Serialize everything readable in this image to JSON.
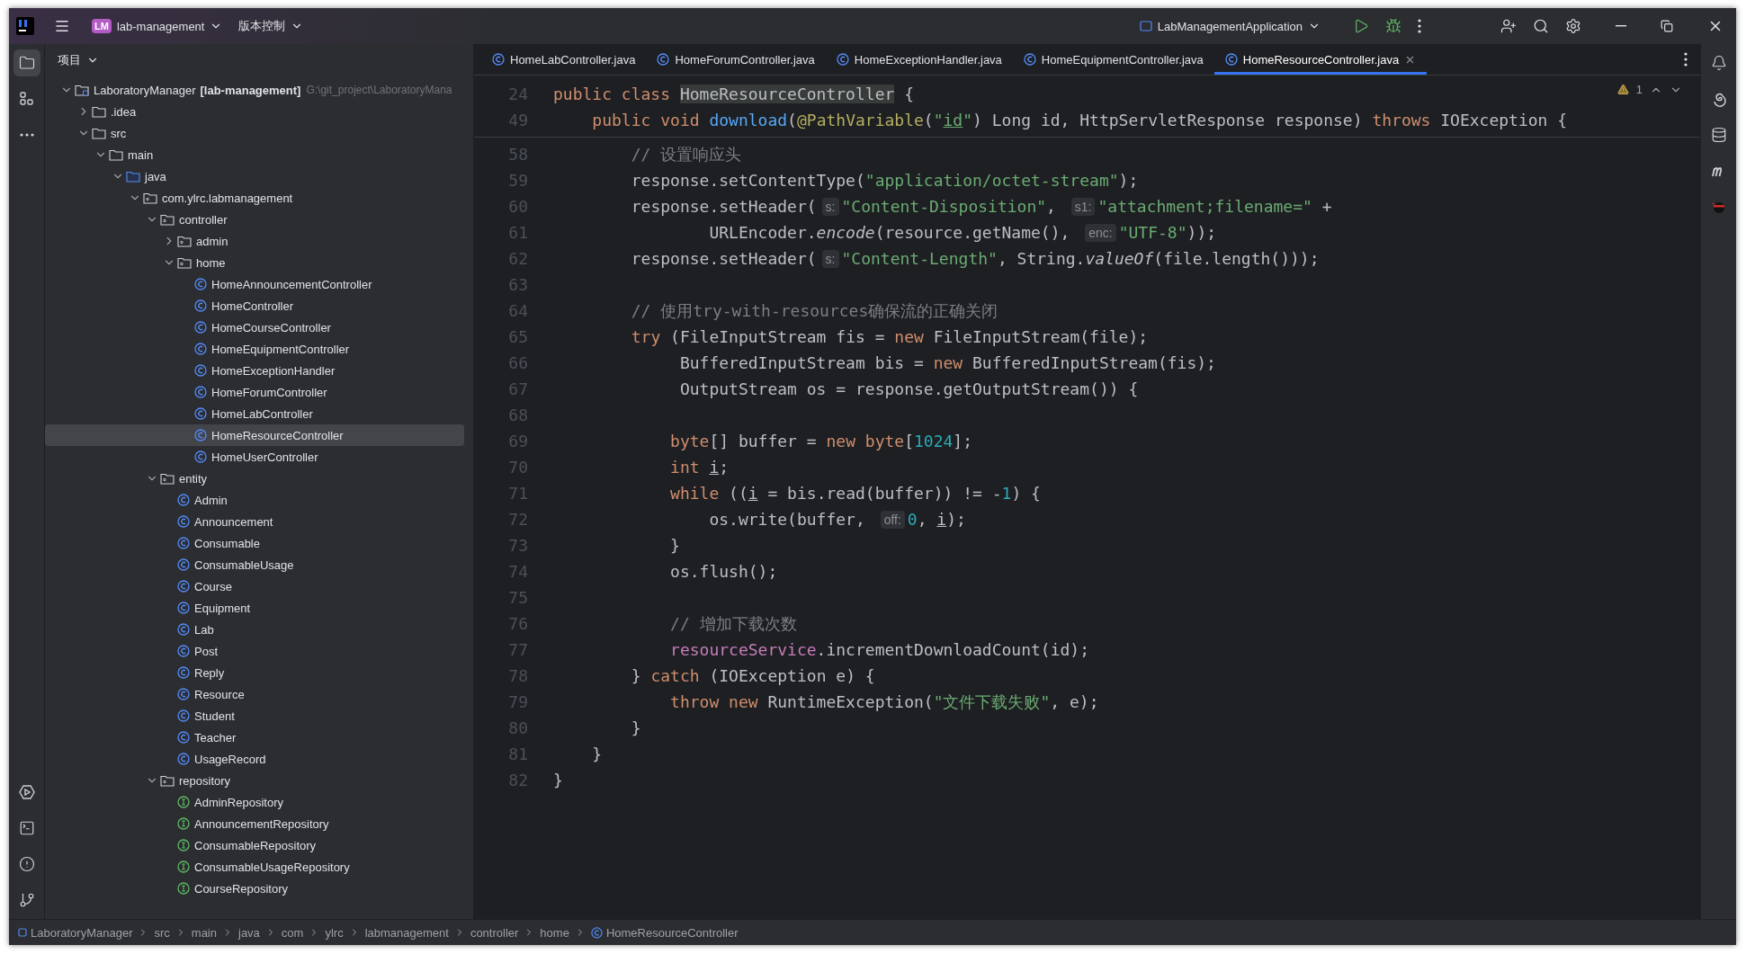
{
  "title_bar": {
    "project": {
      "badge": "LM",
      "name": "lab-management"
    },
    "vcs": "版本控制",
    "run_config": "LabManagementApplication"
  },
  "project_panel": {
    "title": "项目",
    "tree": [
      {
        "label": "LaboratoryManager",
        "module": "[lab-management]",
        "path": "G:\\git_project\\LaboratoryMana",
        "kind": "module",
        "expanded": true,
        "selected": false,
        "children": [
          {
            "label": ".idea",
            "kind": "folder",
            "expanded": false,
            "selected": false
          },
          {
            "label": "src",
            "kind": "folder",
            "expanded": true,
            "selected": false,
            "children": [
              {
                "label": "main",
                "kind": "folder",
                "expanded": true,
                "selected": false,
                "children": [
                  {
                    "label": "java",
                    "kind": "source-root",
                    "expanded": true,
                    "selected": false,
                    "children": [
                      {
                        "label": "com.ylrc.labmanagement",
                        "kind": "package",
                        "expanded": true,
                        "selected": false,
                        "children": [
                          {
                            "label": "controller",
                            "kind": "package",
                            "expanded": true,
                            "selected": false,
                            "children": [
                              {
                                "label": "admin",
                                "kind": "package",
                                "expanded": false,
                                "selected": false
                              },
                              {
                                "label": "home",
                                "kind": "package",
                                "expanded": true,
                                "selected": false,
                                "children": [
                                  {
                                    "label": "HomeAnnouncementController",
                                    "kind": "class",
                                    "selected": false
                                  },
                                  {
                                    "label": "HomeController",
                                    "kind": "class",
                                    "selected": false
                                  },
                                  {
                                    "label": "HomeCourseController",
                                    "kind": "class",
                                    "selected": false
                                  },
                                  {
                                    "label": "HomeEquipmentController",
                                    "kind": "class",
                                    "selected": false
                                  },
                                  {
                                    "label": "HomeExceptionHandler",
                                    "kind": "class",
                                    "selected": false
                                  },
                                  {
                                    "label": "HomeForumController",
                                    "kind": "class",
                                    "selected": false
                                  },
                                  {
                                    "label": "HomeLabController",
                                    "kind": "class",
                                    "selected": false
                                  },
                                  {
                                    "label": "HomeResourceController",
                                    "kind": "class",
                                    "selected": true
                                  },
                                  {
                                    "label": "HomeUserController",
                                    "kind": "class",
                                    "selected": false
                                  }
                                ]
                              }
                            ]
                          },
                          {
                            "label": "entity",
                            "kind": "package",
                            "expanded": true,
                            "selected": false,
                            "children": [
                              {
                                "label": "Admin",
                                "kind": "class",
                                "selected": false
                              },
                              {
                                "label": "Announcement",
                                "kind": "class",
                                "selected": false
                              },
                              {
                                "label": "Consumable",
                                "kind": "class",
                                "selected": false
                              },
                              {
                                "label": "ConsumableUsage",
                                "kind": "class",
                                "selected": false
                              },
                              {
                                "label": "Course",
                                "kind": "class",
                                "selected": false
                              },
                              {
                                "label": "Equipment",
                                "kind": "class",
                                "selected": false
                              },
                              {
                                "label": "Lab",
                                "kind": "class",
                                "selected": false
                              },
                              {
                                "label": "Post",
                                "kind": "class",
                                "selected": false
                              },
                              {
                                "label": "Reply",
                                "kind": "class",
                                "selected": false
                              },
                              {
                                "label": "Resource",
                                "kind": "class",
                                "selected": false
                              },
                              {
                                "label": "Student",
                                "kind": "class",
                                "selected": false
                              },
                              {
                                "label": "Teacher",
                                "kind": "class",
                                "selected": false
                              },
                              {
                                "label": "UsageRecord",
                                "kind": "class",
                                "selected": false
                              }
                            ]
                          },
                          {
                            "label": "repository",
                            "kind": "package",
                            "expanded": true,
                            "selected": false,
                            "children": [
                              {
                                "label": "AdminRepository",
                                "kind": "interface",
                                "selected": false
                              },
                              {
                                "label": "AnnouncementRepository",
                                "kind": "interface",
                                "selected": false
                              },
                              {
                                "label": "ConsumableRepository",
                                "kind": "interface",
                                "selected": false
                              },
                              {
                                "label": "ConsumableUsageRepository",
                                "kind": "interface",
                                "selected": false
                              },
                              {
                                "label": "CourseRepository",
                                "kind": "interface",
                                "selected": false
                              }
                            ]
                          }
                        ]
                      }
                    ]
                  }
                ]
              }
            ]
          }
        ]
      }
    ]
  },
  "tabs": [
    {
      "label": "HomeLabController.java",
      "selected": false
    },
    {
      "label": "HomeForumController.java",
      "selected": false
    },
    {
      "label": "HomeExceptionHandler.java",
      "selected": false
    },
    {
      "label": "HomeEquipmentController.java",
      "selected": false
    },
    {
      "label": "HomeResourceController.java",
      "selected": true
    }
  ],
  "editor": {
    "warnings": "1",
    "sticky_lines": [
      {
        "number": "24",
        "tokens": [
          {
            "kind": "keyword",
            "text": "public class "
          },
          {
            "kind": "usage",
            "text": "HomeResourceController"
          },
          {
            "kind": "plain",
            "text": " {"
          }
        ]
      },
      {
        "number": "49",
        "tokens": [
          {
            "kind": "keyword",
            "text": "    public void "
          },
          {
            "kind": "method-decl",
            "text": "download"
          },
          {
            "kind": "plain",
            "text": "("
          },
          {
            "kind": "annotation",
            "text": "@PathVariable"
          },
          {
            "kind": "plain",
            "text": "("
          },
          {
            "kind": "string",
            "text": "\""
          },
          {
            "kind": "underlined-string",
            "text": "id"
          },
          {
            "kind": "string",
            "text": "\""
          },
          {
            "kind": "plain",
            "text": ") Long id, HttpServletResponse response) "
          },
          {
            "kind": "keyword",
            "text": "throws "
          },
          {
            "kind": "plain",
            "text": "IOException {"
          }
        ]
      }
    ],
    "lines": [
      {
        "number": "58",
        "tokens": [
          {
            "kind": "comment",
            "text": "        // 设置响应头"
          }
        ]
      },
      {
        "number": "59",
        "tokens": [
          {
            "kind": "plain",
            "text": "        response.setContentType("
          },
          {
            "kind": "string",
            "text": "\"application/octet-stream\""
          },
          {
            "kind": "plain",
            "text": ");"
          }
        ]
      },
      {
        "number": "60",
        "tokens": [
          {
            "kind": "plain",
            "text": "        response.setHeader("
          },
          {
            "kind": "hint",
            "text": "s:"
          },
          {
            "kind": "string",
            "text": "\"Content-Disposition\""
          },
          {
            "kind": "plain",
            "text": ", "
          },
          {
            "kind": "hint",
            "text": "s1:"
          },
          {
            "kind": "string",
            "text": "\"attachment;filename=\""
          },
          {
            "kind": "plain",
            "text": " +"
          }
        ]
      },
      {
        "number": "61",
        "tokens": [
          {
            "kind": "plain",
            "text": "                URLEncoder."
          },
          {
            "kind": "static",
            "text": "encode"
          },
          {
            "kind": "plain",
            "text": "(resource.getName(), "
          },
          {
            "kind": "hint",
            "text": "enc:"
          },
          {
            "kind": "string",
            "text": "\"UTF-8\""
          },
          {
            "kind": "plain",
            "text": "));"
          }
        ]
      },
      {
        "number": "62",
        "tokens": [
          {
            "kind": "plain",
            "text": "        response.setHeader("
          },
          {
            "kind": "hint",
            "text": "s:"
          },
          {
            "kind": "string",
            "text": "\"Content-Length\""
          },
          {
            "kind": "plain",
            "text": ", String."
          },
          {
            "kind": "static",
            "text": "valueOf"
          },
          {
            "kind": "plain",
            "text": "(file.length()));"
          }
        ]
      },
      {
        "number": "63"
      },
      {
        "number": "64",
        "tokens": [
          {
            "kind": "comment",
            "text": "        // 使用try-with-resources确保流的正确关闭"
          }
        ]
      },
      {
        "number": "65",
        "tokens": [
          {
            "kind": "keyword",
            "text": "        try "
          },
          {
            "kind": "plain",
            "text": "(FileInputStream fis = "
          },
          {
            "kind": "keyword",
            "text": "new "
          },
          {
            "kind": "plain",
            "text": "FileInputStream(file);"
          }
        ]
      },
      {
        "number": "66",
        "tokens": [
          {
            "kind": "plain",
            "text": "             BufferedInputStream bis = "
          },
          {
            "kind": "keyword",
            "text": "new "
          },
          {
            "kind": "plain",
            "text": "BufferedInputStream(fis);"
          }
        ]
      },
      {
        "number": "67",
        "tokens": [
          {
            "kind": "plain",
            "text": "             OutputStream os = response.getOutputStream()) {"
          }
        ]
      },
      {
        "number": "68"
      },
      {
        "number": "69",
        "tokens": [
          {
            "kind": "keyword",
            "text": "            byte"
          },
          {
            "kind": "plain",
            "text": "[] buffer = "
          },
          {
            "kind": "keyword",
            "text": "new byte"
          },
          {
            "kind": "plain",
            "text": "["
          },
          {
            "kind": "number",
            "text": "1024"
          },
          {
            "kind": "plain",
            "text": "];"
          }
        ]
      },
      {
        "number": "70",
        "tokens": [
          {
            "kind": "keyword",
            "text": "            int "
          },
          {
            "kind": "underlined-var",
            "text": "i"
          },
          {
            "kind": "plain",
            "text": ";"
          }
        ]
      },
      {
        "number": "71",
        "tokens": [
          {
            "kind": "keyword",
            "text": "            while "
          },
          {
            "kind": "plain",
            "text": "(("
          },
          {
            "kind": "underlined-var",
            "text": "i"
          },
          {
            "kind": "plain",
            "text": " = bis.read(buffer)) != -"
          },
          {
            "kind": "number",
            "text": "1"
          },
          {
            "kind": "plain",
            "text": ") {"
          }
        ]
      },
      {
        "number": "72",
        "tokens": [
          {
            "kind": "plain",
            "text": "                os.write(buffer, "
          },
          {
            "kind": "hint",
            "text": "off:"
          },
          {
            "kind": "number",
            "text": "0"
          },
          {
            "kind": "plain",
            "text": ", "
          },
          {
            "kind": "underlined-var",
            "text": "i"
          },
          {
            "kind": "plain",
            "text": ");"
          }
        ]
      },
      {
        "number": "73",
        "tokens": [
          {
            "kind": "plain",
            "text": "            }"
          }
        ]
      },
      {
        "number": "74",
        "tokens": [
          {
            "kind": "plain",
            "text": "            os.flush();"
          }
        ]
      },
      {
        "number": "75"
      },
      {
        "number": "76",
        "tokens": [
          {
            "kind": "comment",
            "text": "            // 增加下载次数"
          }
        ]
      },
      {
        "number": "77",
        "tokens": [
          {
            "kind": "field",
            "text": "            resourceService"
          },
          {
            "kind": "plain",
            "text": ".incrementDownloadCount(id);"
          }
        ]
      },
      {
        "number": "78",
        "tokens": [
          {
            "kind": "plain",
            "text": "        } "
          },
          {
            "kind": "keyword",
            "text": "catch "
          },
          {
            "kind": "plain",
            "text": "(IOException e) {"
          }
        ]
      },
      {
        "number": "79",
        "tokens": [
          {
            "kind": "keyword",
            "text": "            throw new "
          },
          {
            "kind": "plain",
            "text": "RuntimeException("
          },
          {
            "kind": "string",
            "text": "\"文件下载失败\""
          },
          {
            "kind": "plain",
            "text": ", e);"
          }
        ]
      },
      {
        "number": "80",
        "tokens": [
          {
            "kind": "plain",
            "text": "        }"
          }
        ]
      },
      {
        "number": "81",
        "tokens": [
          {
            "kind": "plain",
            "text": "    }"
          }
        ]
      },
      {
        "number": "82",
        "tokens": [
          {
            "kind": "plain",
            "text": "}"
          }
        ]
      }
    ]
  },
  "breadcrumbs": [
    {
      "label": "LaboratoryManager",
      "kind": "module"
    },
    {
      "label": "src",
      "kind": "folder"
    },
    {
      "label": "main",
      "kind": "folder"
    },
    {
      "label": "java",
      "kind": "folder"
    },
    {
      "label": "com",
      "kind": "folder"
    },
    {
      "label": "ylrc",
      "kind": "folder"
    },
    {
      "label": "labmanagement",
      "kind": "folder"
    },
    {
      "label": "controller",
      "kind": "folder"
    },
    {
      "label": "home",
      "kind": "folder"
    },
    {
      "label": "HomeResourceController",
      "kind": "class"
    }
  ]
}
